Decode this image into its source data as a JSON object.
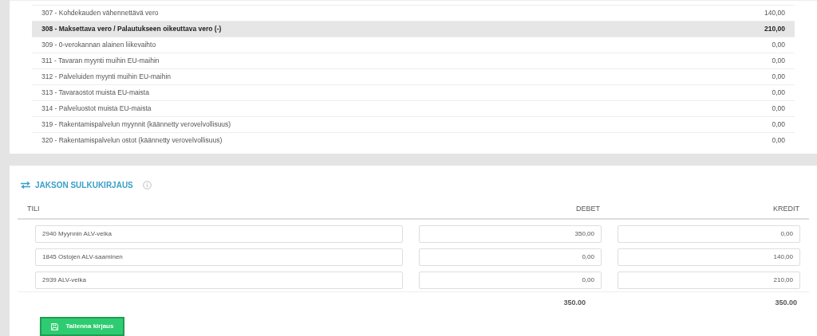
{
  "tax_rows": [
    {
      "label": "307 - Kohdekauden vähennettävä vero",
      "value": "140,00",
      "highlighted": false
    },
    {
      "label": "308 - Maksettava vero / Palautukseen oikeuttava vero (-)",
      "value": "210,00",
      "highlighted": true
    },
    {
      "label": "309 - 0-verokannan alainen liikevaihto",
      "value": "0,00",
      "highlighted": false
    },
    {
      "label": "311 - Tavaran myynti muihin EU-maihin",
      "value": "0,00",
      "highlighted": false
    },
    {
      "label": "312 - Palveluiden myynti muihin EU-maihin",
      "value": "0,00",
      "highlighted": false
    },
    {
      "label": "313 - Tavaraostot muista EU-maista",
      "value": "0,00",
      "highlighted": false
    },
    {
      "label": "314 - Palveluostot muista EU-maista",
      "value": "0,00",
      "highlighted": false
    },
    {
      "label": "319 - Rakentamispalvelun myynnit (käännetty verovelvollisuus)",
      "value": "0,00",
      "highlighted": false
    },
    {
      "label": "320 - Rakentamispalvelun ostot (käännetty verovelvollisuus)",
      "value": "0,00",
      "highlighted": false
    }
  ],
  "closing_entry": {
    "title": "JAKSON SULKUKIRJAUS",
    "columns": [
      "TILI",
      "DEBET",
      "KREDIT"
    ],
    "rows": [
      {
        "account": "2940 Myynnin ALV-velka",
        "debet": "350,00",
        "kredit": "0,00"
      },
      {
        "account": "1845 Ostojen ALV-saaminen",
        "debet": "0,00",
        "kredit": "140,00"
      },
      {
        "account": "2939 ALV-velka",
        "debet": "0,00",
        "kredit": "210,00"
      }
    ],
    "totals": {
      "debet": "350.00",
      "kredit": "350.00"
    },
    "save_button": "Tallenna kirjaus"
  }
}
